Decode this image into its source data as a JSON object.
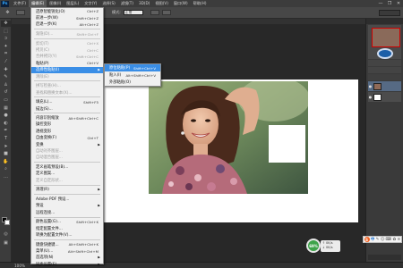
{
  "app": {
    "name": "Ps"
  },
  "menubar": {
    "items": [
      "文件(F)",
      "编辑(E)",
      "图像(I)",
      "图层(L)",
      "文字(Y)",
      "选择(S)",
      "滤镜(T)",
      "3D(D)",
      "视图(V)",
      "窗口(W)",
      "帮助(H)"
    ]
  },
  "window_controls": {
    "minimize": "—",
    "restore": "❐",
    "close": "✕"
  },
  "options": {
    "style_label": "模式:",
    "style_value": "正常",
    "opacity_label": "不透明度:"
  },
  "status": {
    "zoom": "100%"
  },
  "edit_menu": {
    "items": [
      {
        "label": "还原智能锐化(O)",
        "shortcut": "Ctrl+Z",
        "disabled": false
      },
      {
        "label": "前进一步(W)",
        "shortcut": "Shift+Ctrl+Z",
        "disabled": false
      },
      {
        "label": "后退一步(K)",
        "shortcut": "Alt+Ctrl+Z",
        "disabled": false
      },
      {
        "sep": true
      },
      {
        "label": "渐隐(D)...",
        "shortcut": "Shift+Ctrl+F",
        "disabled": true
      },
      {
        "sep": true
      },
      {
        "label": "剪切(T)",
        "shortcut": "Ctrl+X",
        "disabled": true
      },
      {
        "label": "拷贝(C)",
        "shortcut": "Ctrl+C",
        "disabled": true
      },
      {
        "label": "合并拷贝(Y)",
        "shortcut": "Shift+Ctrl+C",
        "disabled": true
      },
      {
        "label": "粘贴(P)",
        "shortcut": "Ctrl+V",
        "disabled": false
      },
      {
        "label": "选择性粘贴(I)",
        "shortcut": "",
        "disabled": false,
        "highlight": true,
        "submenu": true
      },
      {
        "label": "清除(E)",
        "shortcut": "",
        "disabled": true
      },
      {
        "sep": true
      },
      {
        "label": "拼写检查(H)...",
        "shortcut": "",
        "disabled": true
      },
      {
        "label": "查找和替换文本(X)...",
        "shortcut": "",
        "disabled": true
      },
      {
        "sep": true
      },
      {
        "label": "填充(L)...",
        "shortcut": "Shift+F5",
        "disabled": false
      },
      {
        "label": "描边(S)...",
        "shortcut": "",
        "disabled": false
      },
      {
        "sep": true
      },
      {
        "label": "内容识别缩放",
        "shortcut": "Alt+Shift+Ctrl+C",
        "disabled": false
      },
      {
        "label": "操控变形",
        "shortcut": "",
        "disabled": false
      },
      {
        "label": "透视变形",
        "shortcut": "",
        "disabled": false
      },
      {
        "label": "自由变换(F)",
        "shortcut": "Ctrl+T",
        "disabled": false
      },
      {
        "label": "变换",
        "shortcut": "",
        "disabled": false,
        "submenu": true
      },
      {
        "label": "自动对齐图层...",
        "shortcut": "",
        "disabled": true
      },
      {
        "label": "自动混合图层...",
        "shortcut": "",
        "disabled": true
      },
      {
        "sep": true
      },
      {
        "label": "定义画笔预设(B)...",
        "shortcut": "",
        "disabled": false
      },
      {
        "label": "定义图案...",
        "shortcut": "",
        "disabled": false
      },
      {
        "label": "定义自定形状...",
        "shortcut": "",
        "disabled": true
      },
      {
        "sep": true
      },
      {
        "label": "清理(R)",
        "shortcut": "",
        "disabled": false,
        "submenu": true
      },
      {
        "sep": true
      },
      {
        "label": "Adobe PDF 预设...",
        "shortcut": "",
        "disabled": false
      },
      {
        "label": "预设",
        "shortcut": "",
        "disabled": false,
        "submenu": true
      },
      {
        "label": "远程连接...",
        "shortcut": "",
        "disabled": false
      },
      {
        "sep": true
      },
      {
        "label": "颜色设置(G)...",
        "shortcut": "Shift+Ctrl+K",
        "disabled": false
      },
      {
        "label": "指定配置文件...",
        "shortcut": "",
        "disabled": false
      },
      {
        "label": "转换为配置文件(V)...",
        "shortcut": "",
        "disabled": false
      },
      {
        "sep": true
      },
      {
        "label": "键盘快捷键...",
        "shortcut": "Alt+Shift+Ctrl+K",
        "disabled": false
      },
      {
        "label": "菜单(U)...",
        "shortcut": "Alt+Shift+Ctrl+M",
        "disabled": false
      },
      {
        "label": "首选项(N)",
        "shortcut": "",
        "disabled": false,
        "submenu": true
      },
      {
        "label": "同步设置(E)",
        "shortcut": "",
        "disabled": false,
        "submenu": true
      }
    ]
  },
  "paste_submenu": {
    "items": [
      {
        "label": "原位粘贴(P)",
        "shortcut": "Shift+Ctrl+V",
        "highlight": true
      },
      {
        "label": "贴入(I)",
        "shortcut": "Alt+Shift+Ctrl+V",
        "highlight": false
      },
      {
        "label": "外部粘贴(O)",
        "shortcut": "",
        "highlight": false
      }
    ]
  },
  "speed_widget": {
    "percent": "69%",
    "up": "0K/s",
    "down": "0K/s"
  },
  "ime": {
    "logo": "S",
    "lang": "中",
    "icons": [
      "✎",
      "☺",
      "⌨",
      "✿",
      "≡"
    ]
  },
  "colors": {
    "accent": "#3a8ee6",
    "background": "#282828",
    "panel": "#3c3c3c"
  }
}
